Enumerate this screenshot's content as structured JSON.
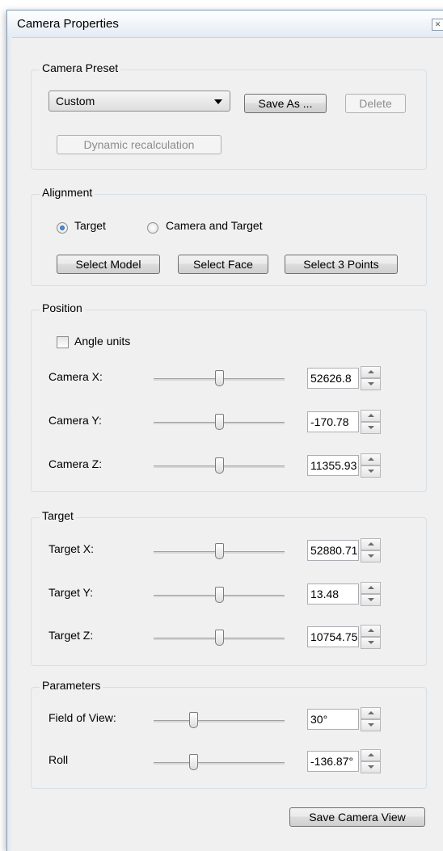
{
  "window": {
    "title": "Camera Properties",
    "close_icon": "close-icon"
  },
  "preset": {
    "label": "Camera Preset",
    "selected": "Custom",
    "save_as": "Save As ...",
    "delete": "Delete",
    "dynamic": "Dynamic recalculation"
  },
  "alignment": {
    "label": "Alignment",
    "options": [
      {
        "label": "Target",
        "checked": true
      },
      {
        "label": "Camera and Target",
        "checked": false
      }
    ],
    "buttons": [
      "Select Model",
      "Select Face",
      "Select 3 Points"
    ]
  },
  "position": {
    "label": "Position",
    "angle_units": "Angle units",
    "angle_units_checked": false,
    "rows": [
      {
        "label": "Camera X:",
        "value": "52626.8",
        "slider": 0.5
      },
      {
        "label": "Camera Y:",
        "value": "-170.78",
        "slider": 0.5
      },
      {
        "label": "Camera Z:",
        "value": "11355.93",
        "slider": 0.5
      }
    ]
  },
  "target": {
    "label": "Target",
    "rows": [
      {
        "label": "Target X:",
        "value": "52880.71",
        "slider": 0.5
      },
      {
        "label": "Target Y:",
        "value": "13.48",
        "slider": 0.5
      },
      {
        "label": "Target Z:",
        "value": "10754.75",
        "slider": 0.5
      }
    ]
  },
  "parameters": {
    "label": "Parameters",
    "rows": [
      {
        "label": "Field of View:",
        "value": "30°",
        "slider": 0.3
      },
      {
        "label": "Roll",
        "value": "-136.87°",
        "slider": 0.3
      }
    ]
  },
  "footer": {
    "save_camera_view": "Save Camera View"
  }
}
